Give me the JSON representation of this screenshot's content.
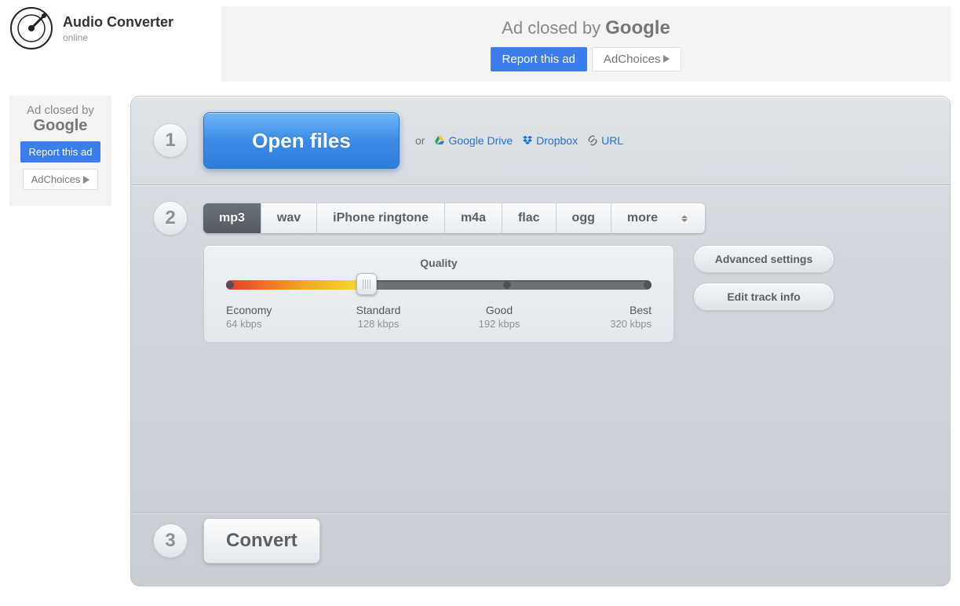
{
  "header": {
    "title": "Audio Converter",
    "subtitle": "online"
  },
  "ads": {
    "closed_prefix": "Ad closed by",
    "google_word": "Google",
    "report_label": "Report this ad",
    "adchoices_label": "AdChoices"
  },
  "step1": {
    "num": "1",
    "open_label": "Open files",
    "or_label": "or",
    "gdrive_label": "Google Drive",
    "dropbox_label": "Dropbox",
    "url_label": "URL"
  },
  "step2": {
    "num": "2",
    "formats": [
      "mp3",
      "wav",
      "iPhone ringtone",
      "m4a",
      "flac",
      "ogg",
      "more"
    ],
    "active_format_index": 0,
    "quality_title": "Quality",
    "quality_levels": [
      {
        "name": "Economy",
        "rate": "64 kbps"
      },
      {
        "name": "Standard",
        "rate": "128 kbps"
      },
      {
        "name": "Good",
        "rate": "192 kbps"
      },
      {
        "name": "Best",
        "rate": "320 kbps"
      }
    ],
    "advanced_label": "Advanced settings",
    "trackinfo_label": "Edit track info"
  },
  "step3": {
    "num": "3",
    "convert_label": "Convert"
  }
}
